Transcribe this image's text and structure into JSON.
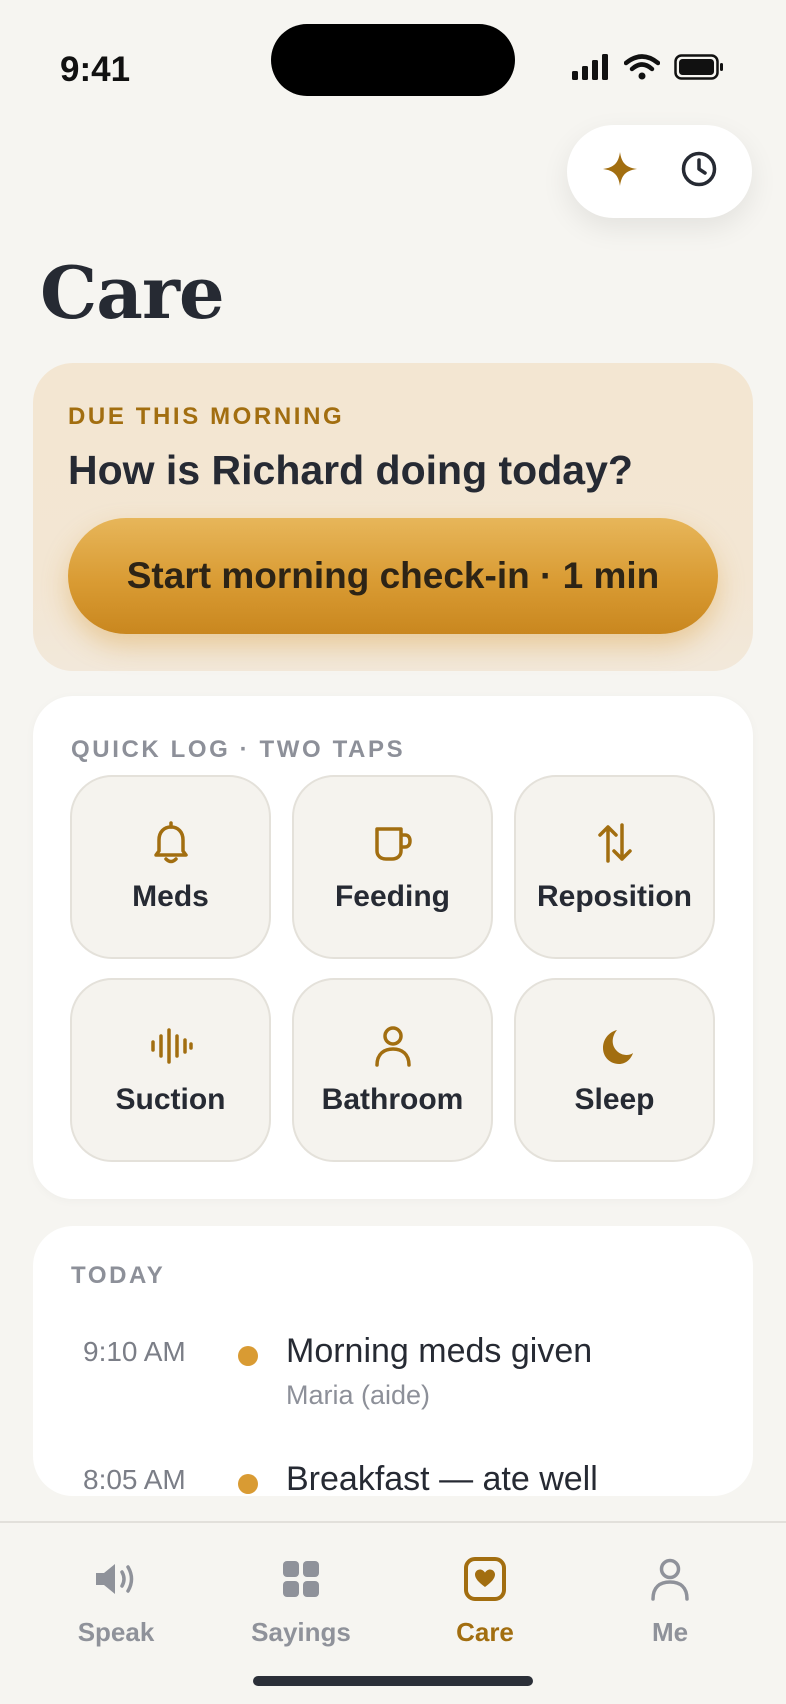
{
  "status": {
    "time": "9:41"
  },
  "header": {
    "title": "Care",
    "actions": [
      {
        "icon": "sparkle-icon",
        "label": ""
      },
      {
        "icon": "clock-icon",
        "label": ""
      }
    ]
  },
  "checkin": {
    "eyebrow": "DUE THIS MORNING",
    "question": "How is Richard doing today?",
    "button_label": "Start morning check-in · 1 min"
  },
  "quick_log": {
    "eyebrow": "QUICK LOG · TWO TAPS",
    "items": [
      {
        "label": "Meds",
        "icon": "bell-icon"
      },
      {
        "label": "Feeding",
        "icon": "mug-icon"
      },
      {
        "label": "Reposition",
        "icon": "swap-vertical-icon"
      },
      {
        "label": "Suction",
        "icon": "waveform-icon"
      },
      {
        "label": "Bathroom",
        "icon": "person-icon"
      },
      {
        "label": "Sleep",
        "icon": "moon-icon"
      }
    ]
  },
  "today": {
    "eyebrow": "TODAY",
    "entries": [
      {
        "time": "9:10 AM",
        "title": "Morning meds given",
        "subtitle": "Maria (aide)"
      },
      {
        "time": "8:05 AM",
        "title": "Breakfast — ate well",
        "subtitle": ""
      }
    ]
  },
  "tabs": [
    {
      "label": "Speak",
      "icon": "speaker-icon",
      "active": false
    },
    {
      "label": "Sayings",
      "icon": "grid-icon",
      "active": false
    },
    {
      "label": "Care",
      "icon": "heart-square-icon",
      "active": true
    },
    {
      "label": "Me",
      "icon": "person-icon",
      "active": false
    }
  ],
  "colors": {
    "accent": "#a26e10",
    "button_gradient_top": "#e7b65a",
    "button_gradient_bottom": "#c9871f",
    "background": "#f6f5f1"
  }
}
